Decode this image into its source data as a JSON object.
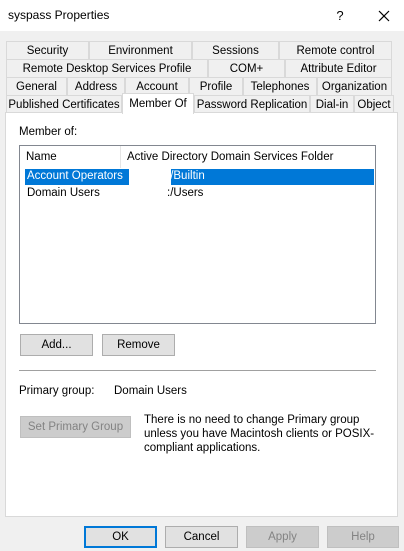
{
  "window": {
    "title": "syspass Properties",
    "help_glyph": "?",
    "close_glyph": "✕"
  },
  "tabs": {
    "row1": [
      "Security",
      "Environment",
      "Sessions",
      "Remote control"
    ],
    "row2": [
      "Remote Desktop Services Profile",
      "COM+",
      "Attribute Editor"
    ],
    "row3": [
      "General",
      "Address",
      "Account",
      "Profile",
      "Telephones",
      "Organization"
    ],
    "row4": [
      "Published Certificates",
      "Member Of",
      "Password Replication",
      "Dial-in",
      "Object"
    ],
    "active": "Member Of"
  },
  "member_of": {
    "label": "Member of:",
    "columns": [
      "Name",
      "Active Directory Domain Services Folder"
    ],
    "rows": [
      {
        "name": "Account Operators",
        "folder": ":/Builtin",
        "selected": true
      },
      {
        "name": "Domain Users",
        "folder": ":/Users",
        "selected": false
      }
    ],
    "selection_color": "#0078d7"
  },
  "buttons": {
    "add": "Add...",
    "remove": "Remove",
    "set_primary": "Set Primary Group",
    "ok": "OK",
    "cancel": "Cancel",
    "apply": "Apply",
    "help": "Help"
  },
  "primary_group": {
    "label": "Primary group:",
    "value": "Domain Users",
    "info": "There is no need to change Primary group unless you have Macintosh clients or POSIX-compliant applications."
  }
}
